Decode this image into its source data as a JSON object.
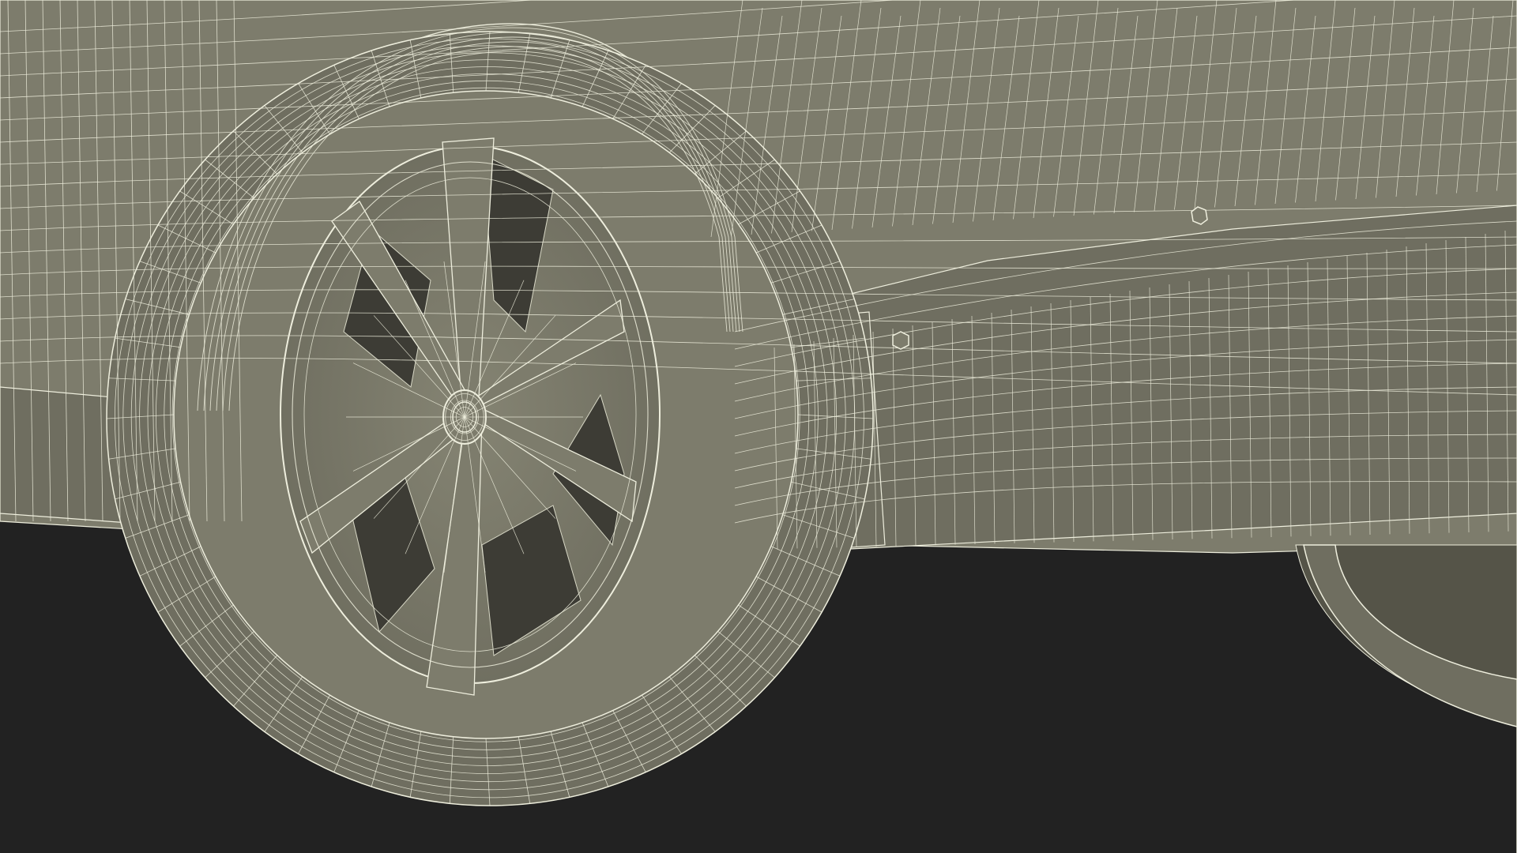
{
  "scene": {
    "subject": "3d-car-wireframe-render",
    "icons": [
      "wheel-icon",
      "tire-icon",
      "hub-icon",
      "side-skirt-icon",
      "fender-icon"
    ]
  },
  "colors": {
    "floor": "#222222",
    "body": "#7d7c6c",
    "body_shade": "#6f6e60",
    "body_dark": "#555448",
    "recess": "#3d3c35",
    "wire": "#eeeedd",
    "wire_dim": "#d8d8c6"
  }
}
